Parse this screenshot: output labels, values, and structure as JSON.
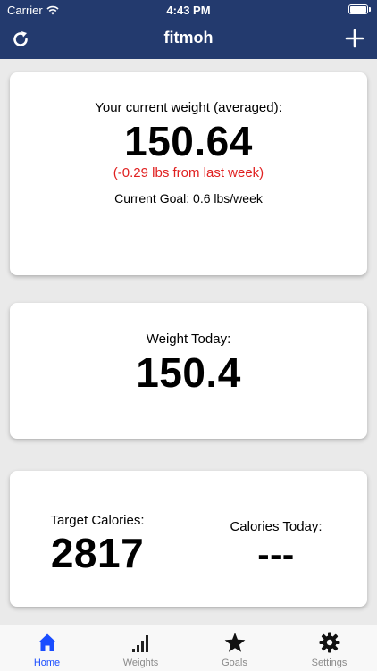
{
  "status_bar": {
    "carrier": "Carrier",
    "time": "4:43 PM"
  },
  "nav": {
    "title": "fitmoh",
    "left_icon": "refresh-icon",
    "right_icon": "plus-icon"
  },
  "weight_card": {
    "label": "Your current weight (averaged):",
    "value": "150.64",
    "change": "(-0.29 lbs from last week)",
    "goal": "Current Goal: 0.6 lbs/week"
  },
  "today_card": {
    "label": "Weight Today:",
    "value": "150.4"
  },
  "calories_card": {
    "target_label": "Target Calories:",
    "target_value": "2817",
    "today_label": "Calories Today:",
    "today_value": "---"
  },
  "tabs": [
    {
      "label": "Home",
      "icon": "home-icon",
      "active": true
    },
    {
      "label": "Weights",
      "icon": "signal-bars-icon",
      "active": false
    },
    {
      "label": "Goals",
      "icon": "star-icon",
      "active": false
    },
    {
      "label": "Settings",
      "icon": "gear-icon",
      "active": false
    }
  ],
  "colors": {
    "nav_bg": "#233a6e",
    "accent": "#1a4dff",
    "negative": "#e02020"
  }
}
